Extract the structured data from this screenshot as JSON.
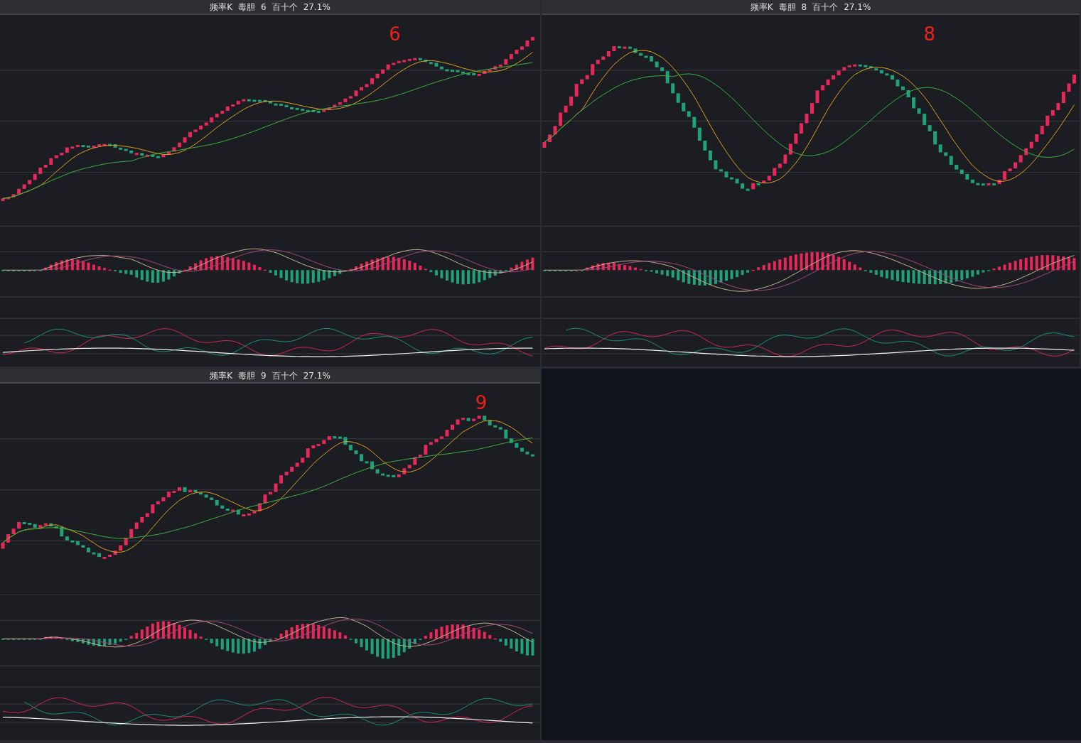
{
  "panels": [
    {
      "title": [
        "频率K",
        "毒胆",
        "6",
        "百十个",
        "27.1%"
      ],
      "marker": "6"
    },
    {
      "title": [
        "频率K",
        "毒胆",
        "8",
        "百十个",
        "27.1%"
      ],
      "marker": "8"
    },
    {
      "title": [
        "频率K",
        "毒胆",
        "9",
        "百十个",
        "27.1%"
      ],
      "marker": "9"
    }
  ]
}
